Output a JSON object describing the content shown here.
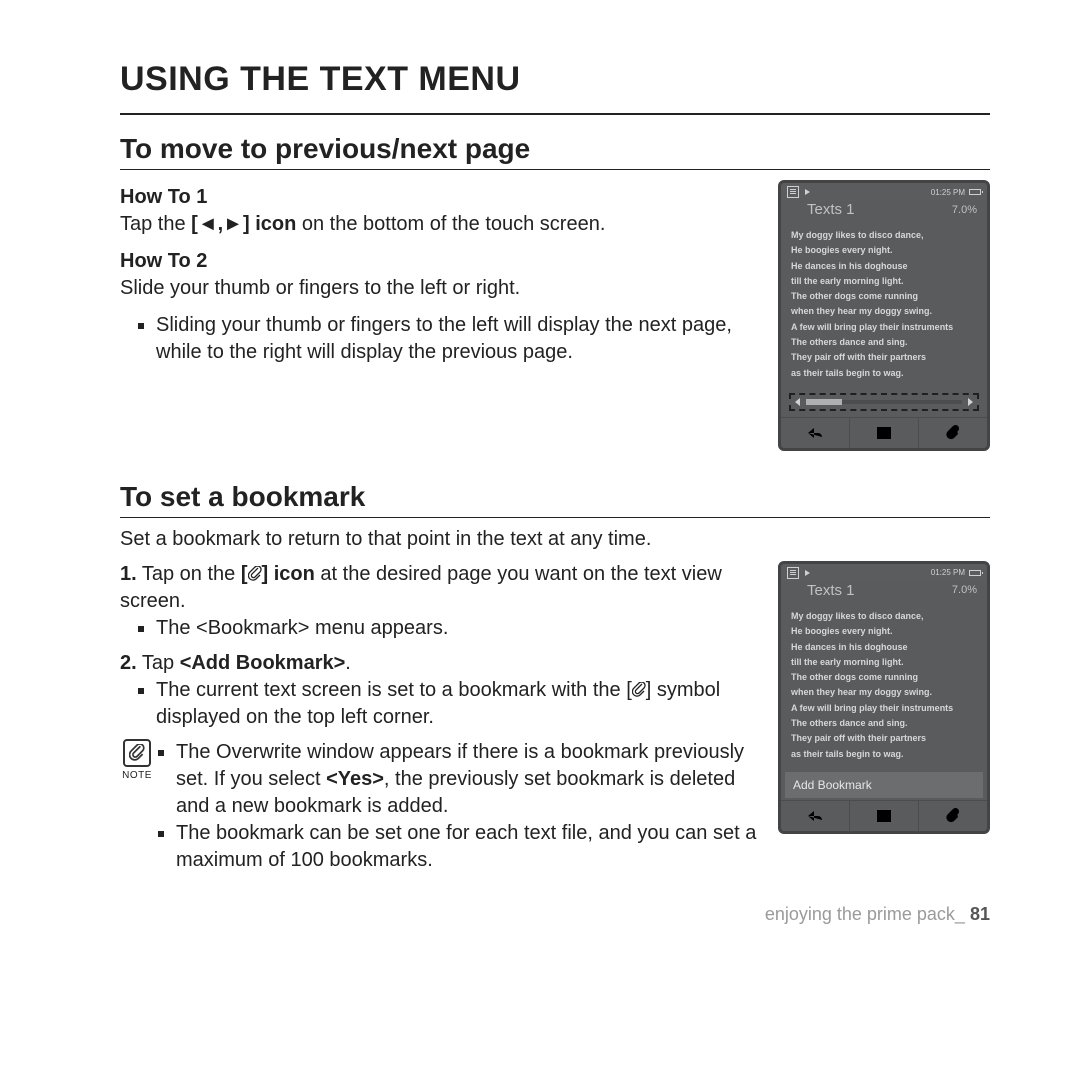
{
  "page_title": "USING THE TEXT MENU",
  "section1": {
    "heading": "To move to previous/next page",
    "howto1_label": "How To 1",
    "howto1_pre": "Tap the ",
    "howto1_bold": "[◄,►] icon",
    "howto1_post": " on the bottom of the touch screen.",
    "howto2_label": "How To 2",
    "howto2_text": "Slide your thumb or fingers to the left or right.",
    "howto2_bullet": "Sliding your thumb or fingers to the left will display the next page, while to the right will display the previous page."
  },
  "section2": {
    "heading": "To set a bookmark",
    "intro": "Set a bookmark to return to that point in the text at any time.",
    "step1_num": "1.",
    "step1_pre": " Tap on the ",
    "step1_bold": "] icon",
    "step1_post": " at the desired page you want on the text view screen.",
    "step1_sub": "The <Bookmark> menu appears.",
    "step2_num": "2.",
    "step2_pre": " Tap ",
    "step2_bold": "<Add Bookmark>",
    "step2_post": ".",
    "step2_sub_pre": "The current text screen is set to a bookmark with the [",
    "step2_sub_post": "] symbol displayed on the top left corner.",
    "note_label": "NOTE",
    "note1_pre": "The Overwrite window appears if there is a bookmark previously set. If you select ",
    "note1_bold": "<Yes>",
    "note1_post": ", the previously set bookmark is deleted and a new bookmark is added.",
    "note2": "The bookmark can be set one for each text file, and you can set a maximum of 100 bookmarks."
  },
  "device": {
    "time": "01:25 PM",
    "title": "Texts 1",
    "percent": "7.0%",
    "lines": [
      "My doggy likes to disco dance,",
      "He boogies every night.",
      "He dances in his doghouse",
      "till the early morning light.",
      "The other dogs come running",
      "when they hear my doggy swing.",
      "A few will bring play their instruments",
      "The others dance and sing.",
      "They pair off with their partners",
      "as their tails begin to wag."
    ],
    "add_bookmark": "Add Bookmark"
  },
  "footer": {
    "text": "enjoying the prime pack_",
    "page": "81"
  }
}
